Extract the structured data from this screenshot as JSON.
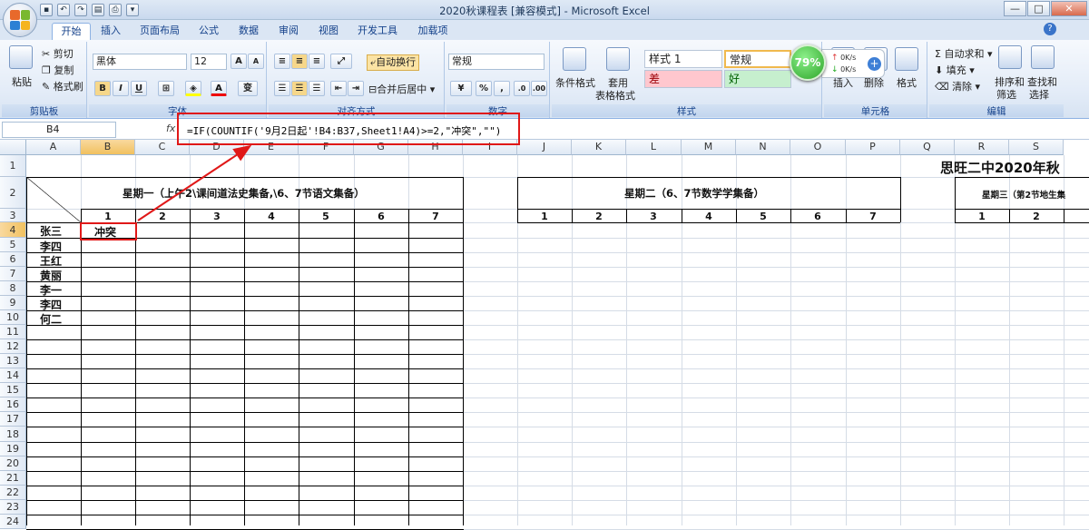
{
  "window": {
    "title": "2020秋课程表  [兼容模式] - Microsoft Excel",
    "controls": [
      "—",
      "□",
      "✕"
    ]
  },
  "tabs": [
    {
      "label": "开始",
      "active": true
    },
    {
      "label": "插入"
    },
    {
      "label": "页面布局"
    },
    {
      "label": "公式"
    },
    {
      "label": "数据"
    },
    {
      "label": "审阅"
    },
    {
      "label": "视图"
    },
    {
      "label": "开发工具"
    },
    {
      "label": "加载项"
    }
  ],
  "ribbon": {
    "clipboard": {
      "label": "剪贴板",
      "paste": "粘贴",
      "cut": "剪切",
      "copy": "复制",
      "format_painter": "格式刷"
    },
    "font": {
      "label": "字体",
      "name": "黑体",
      "size": "12",
      "bold": "B",
      "italic": "I",
      "underline": "U",
      "grow": "A",
      "shrink": "A",
      "font_color": "A",
      "phonetic": "变"
    },
    "alignment": {
      "label": "对齐方式",
      "wrap": "自动换行",
      "merge": "合并后居中"
    },
    "number": {
      "label": "数字",
      "format": "常规",
      "percent": "%",
      "comma": ","
    },
    "styles": {
      "label": "样式",
      "conditional": "条件格式",
      "table_line1": "套用",
      "table_line2": "表格格式",
      "style1": "样式 1",
      "normal": "常规",
      "bad": "差",
      "good": "好"
    },
    "cells": {
      "label": "单元格",
      "insert": "插入",
      "delete": "删除",
      "format": "格式"
    },
    "editing": {
      "label": "编辑",
      "autosum": "自动求和",
      "fill": "填充",
      "clear": "清除",
      "sort_line1": "排序和",
      "sort_line2": "筛选",
      "find_line1": "查找和",
      "find_line2": "选择"
    },
    "colors": {
      "bad_bg": "#ffc7ce",
      "good_bg": "#c6efce",
      "accent": "#15428b"
    }
  },
  "netmeter": {
    "percent": "79%",
    "up": "0K/s",
    "down": "0K/s"
  },
  "formula_bar": {
    "name_box": "B4",
    "fx": "fx",
    "formula": "=IF(COUNTIF('9月2日起'!B4:B37,Sheet1!A4)>=2,\"冲突\",\"\")"
  },
  "columns": [
    "A",
    "B",
    "C",
    "D",
    "E",
    "F",
    "G",
    "H",
    "I",
    "J",
    "K",
    "L",
    "M",
    "N",
    "O",
    "P",
    "Q",
    "R",
    "S"
  ],
  "rows": [
    "1",
    "2",
    "3",
    "4",
    "5",
    "6",
    "7",
    "8",
    "9",
    "10",
    "11",
    "12",
    "13",
    "14",
    "15",
    "16",
    "17",
    "18",
    "19",
    "20",
    "21",
    "22",
    "23",
    "24"
  ],
  "sheet": {
    "title": "思旺二中2020年秋",
    "day1_header": "星期一（上午2\\课间道法史集备,\\6、7节语文集备）",
    "day2_header": "星期二（6、7节数学学集备）",
    "day3_header": "星期三（第2节地生集",
    "day1_periods": [
      "1",
      "2",
      "3",
      "4",
      "5",
      "6",
      "7"
    ],
    "day2_periods": [
      "1",
      "2",
      "3",
      "4",
      "5",
      "6",
      "7"
    ],
    "day3_periods": [
      "1",
      "2"
    ],
    "teachers": [
      "张三",
      "李四",
      "王红",
      "黄丽",
      "李一",
      "李四",
      "何二"
    ],
    "b4_value": "冲突"
  }
}
